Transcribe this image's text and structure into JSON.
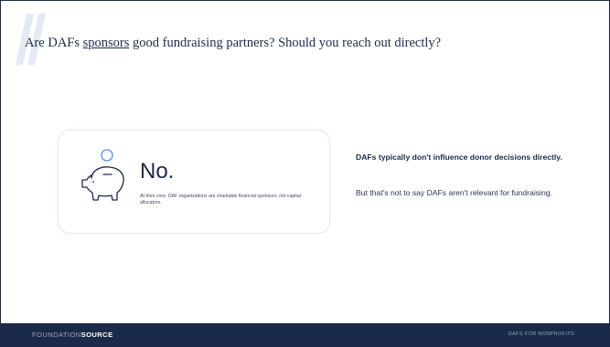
{
  "slide": {
    "title_before": "Are DAFs ",
    "title_link": "sponsors",
    "title_after": " good fundraising partners? Should you reach out directly?"
  },
  "card": {
    "icon": "piggy-bank-icon",
    "answer": "No.",
    "note": "At their core, DAF organizations are charitable financial sponsors, not capital allocators."
  },
  "point": {
    "heading": "DAFs typically don't influence donor decisions directly.",
    "body": "But that's not to say DAFs aren't relevant for fundraising."
  },
  "footer": {
    "brand_light": "FOUNDATION",
    "brand_bold": "SOURCE",
    "tag": "DAFS FOR NONPROFITS"
  },
  "colors": {
    "navy": "#1b2a49",
    "accent_blue": "#5b8fd6",
    "card_border": "#e4e7ec"
  }
}
